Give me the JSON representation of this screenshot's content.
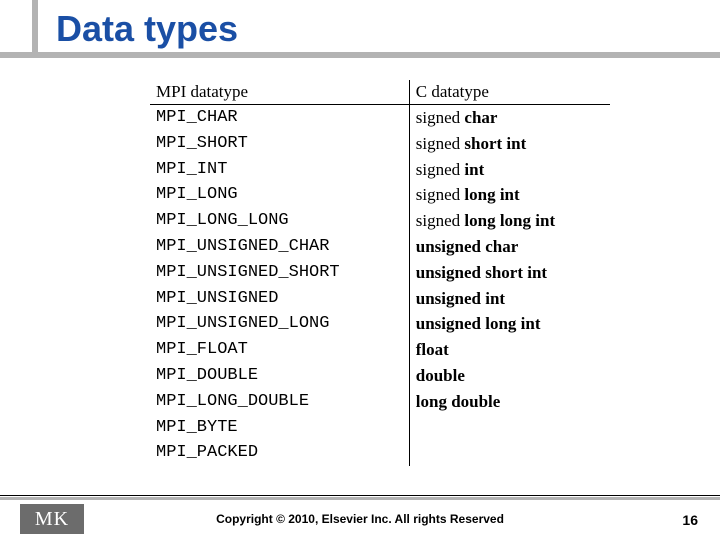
{
  "title": "Data types",
  "table": {
    "headers": {
      "mpi": "MPI datatype",
      "c": "C datatype"
    },
    "rows": [
      {
        "mpi": "MPI_CHAR",
        "c_html": "signed <span class='kw'>char</span>"
      },
      {
        "mpi": "MPI_SHORT",
        "c_html": "signed <span class='kw'>short int</span>"
      },
      {
        "mpi": "MPI_INT",
        "c_html": "signed <span class='kw'>int</span>"
      },
      {
        "mpi": "MPI_LONG",
        "c_html": "signed <span class='kw'>long int</span>"
      },
      {
        "mpi": "MPI_LONG_LONG",
        "c_html": "signed <span class='kw'>long long int</span>"
      },
      {
        "mpi": "MPI_UNSIGNED_CHAR",
        "c_html": "<span class='kw'>unsigned char</span>"
      },
      {
        "mpi": "MPI_UNSIGNED_SHORT",
        "c_html": "<span class='kw'>unsigned short int</span>"
      },
      {
        "mpi": "MPI_UNSIGNED",
        "c_html": "<span class='kw'>unsigned int</span>"
      },
      {
        "mpi": "MPI_UNSIGNED_LONG",
        "c_html": "<span class='kw'>unsigned long int</span>"
      },
      {
        "mpi": "MPI_FLOAT",
        "c_html": "<span class='kw'>float</span>"
      },
      {
        "mpi": "MPI_DOUBLE",
        "c_html": "<span class='kw'>double</span>"
      },
      {
        "mpi": "MPI_LONG_DOUBLE",
        "c_html": "<span class='kw'>long double</span>"
      },
      {
        "mpi": "MPI_BYTE",
        "c_html": ""
      },
      {
        "mpi": "MPI_PACKED",
        "c_html": ""
      }
    ]
  },
  "footer": {
    "logo_text": "MK",
    "copyright": "Copyright © 2010, Elsevier Inc. All rights Reserved",
    "page_number": "16"
  }
}
